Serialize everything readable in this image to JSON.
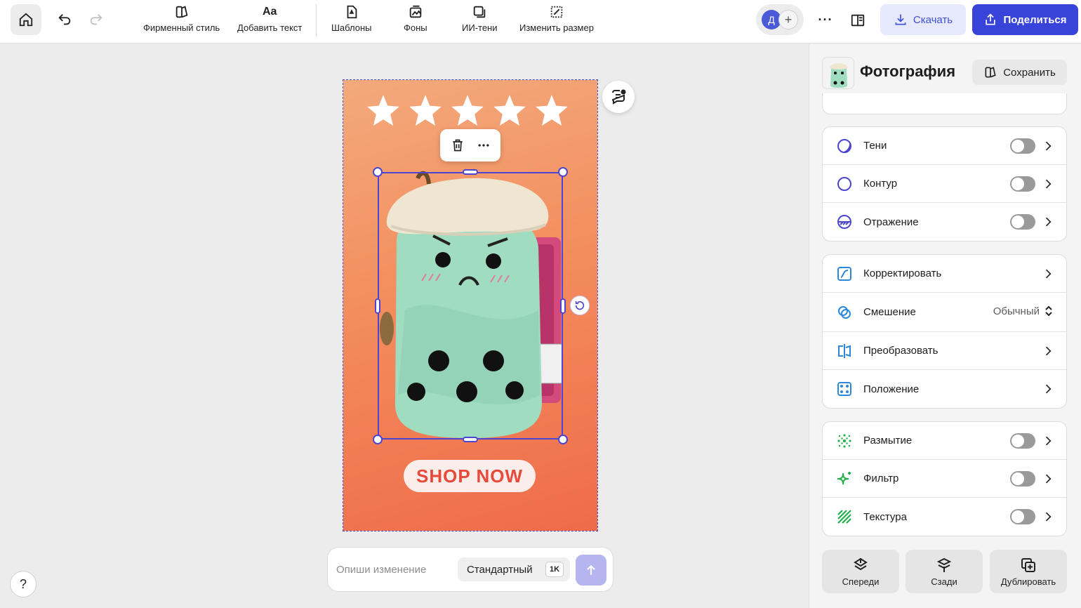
{
  "toolbar": {
    "tools": [
      {
        "label": "Фирменный стиль",
        "icon": "brand-style-icon"
      },
      {
        "label": "Добавить текст",
        "icon_text": "Aa"
      },
      {
        "label": "Шаблоны",
        "icon": "templates-icon"
      },
      {
        "label": "Фоны",
        "icon": "backgrounds-icon"
      },
      {
        "label": "ИИ-тени",
        "icon": "ai-shadows-icon"
      },
      {
        "label": "Изменить размер",
        "icon": "resize-icon"
      }
    ],
    "avatar_initial": "Д",
    "avatar_add": "+",
    "more": "···",
    "download_label": "Скачать",
    "share_label": "Поделиться"
  },
  "canvas": {
    "cta_text": "SHOP NOW",
    "stars_count": 5,
    "prompt_placeholder": "Опиши изменение",
    "quality_label": "Стандартный",
    "resolution": "1K",
    "help": "?"
  },
  "panel": {
    "title": "Фотография",
    "save_label": "Сохранить",
    "groups": [
      [
        {
          "label": "Тени",
          "toggle": true,
          "icon": "shadow-icon",
          "color": "#4b45d1"
        },
        {
          "label": "Контур",
          "toggle": true,
          "icon": "outline-icon",
          "color": "#4b45d1"
        },
        {
          "label": "Отражение",
          "toggle": true,
          "icon": "reflection-icon",
          "color": "#4b45d1"
        }
      ],
      [
        {
          "label": "Корректировать",
          "toggle": false,
          "icon": "adjust-icon",
          "color": "#2c88d9"
        },
        {
          "label": "Смешение",
          "toggle": false,
          "icon": "blend-icon",
          "color": "#2c88d9",
          "value": "Обычный"
        },
        {
          "label": "Преобразовать",
          "toggle": false,
          "icon": "transform-icon",
          "color": "#2c88d9"
        },
        {
          "label": "Положение",
          "toggle": false,
          "icon": "position-icon",
          "color": "#2c88d9"
        }
      ],
      [
        {
          "label": "Размытие",
          "toggle": true,
          "icon": "blur-icon",
          "color": "#22b14c"
        },
        {
          "label": "Фильтр",
          "toggle": true,
          "icon": "filter-icon",
          "color": "#22b14c"
        },
        {
          "label": "Текстура",
          "toggle": true,
          "icon": "texture-icon",
          "color": "#22b14c"
        }
      ]
    ],
    "bottom": [
      {
        "label": "Спереди",
        "icon": "bring-front-icon"
      },
      {
        "label": "Сзади",
        "icon": "send-back-icon"
      },
      {
        "label": "Дублировать",
        "icon": "duplicate-icon"
      }
    ]
  },
  "colors": {
    "accent": "#3843d9",
    "selection": "#4b45d1",
    "cta_text": "#e74a3b",
    "plush": "#9fdcc0"
  }
}
